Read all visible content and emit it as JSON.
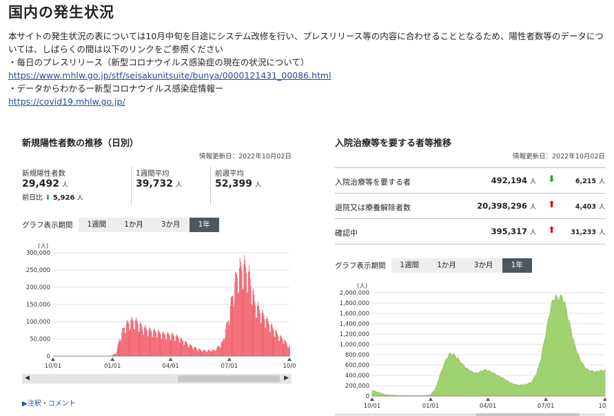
{
  "page": {
    "title": "国内の発生状況",
    "intro_line1": "本サイトの発生状況の表については10月中旬を目途にシステム改修を行い、プレスリリース等の内容に合わせることとなるため、陽性者数等のデータにつ",
    "intro_line2": "いては、しばらくの間は以下のリンクをご参照ください",
    "intro_line3": "・毎日のプレスリリース（新型コロナウイルス感染症の現在の状況について）",
    "link1": "https://www.mhlw.go.jp/stf/seisakunitsuite/bunya/0000121431_00086.html",
    "intro_line4": "・データからわかるー新型コロナウイルス感染症情報ー",
    "link2": "https://covid19.mhlw.go.jp/"
  },
  "left_panel": {
    "title": "新規陽性者数の推移（日別）",
    "updated": "情報更新日：2022年10月02日",
    "stats": [
      {
        "label": "新規陽性者数",
        "value": "29,492",
        "unit": "人"
      },
      {
        "label": "1週間平均",
        "value": "39,732",
        "unit": "人"
      },
      {
        "label": "前週平均",
        "value": "52,399",
        "unit": "人"
      }
    ],
    "prev_day_label": "前日比",
    "prev_day_arrow": "⬇",
    "prev_day_value": "5,926",
    "prev_day_unit": "人",
    "period_label": "グラフ表示期間",
    "period_buttons": [
      "1週間",
      "1か月",
      "3か月",
      "1年"
    ],
    "active_period": "1年",
    "note": "▶注釈・コメント"
  },
  "right_panel": {
    "title": "入院治療等を要する者等推移",
    "updated": "情報更新日：2022年10月02日",
    "rows": [
      {
        "label": "入院治療等を要する者",
        "value": "492,194",
        "unit": "人",
        "arrow": "⬇",
        "dir": "down",
        "delta": "6,215",
        "delta_unit": "人"
      },
      {
        "label": "退院又は療養解除者数",
        "value": "20,398,296",
        "unit": "人",
        "arrow": "⬆",
        "dir": "up",
        "delta": "4,403",
        "delta_unit": "人"
      },
      {
        "label": "確認中",
        "value": "395,317",
        "unit": "人",
        "arrow": "⬆",
        "dir": "up",
        "delta": "31,233",
        "delta_unit": "人"
      }
    ],
    "period_label": "グラフ表示期間",
    "period_buttons": [
      "1週間",
      "1か月",
      "3か月",
      "1年"
    ],
    "active_period": "1年"
  },
  "chart_data": [
    {
      "type": "bar",
      "ylabel": "(人)",
      "ylim": [
        0,
        300000
      ],
      "yticks": [
        "0",
        "50,000",
        "100,000",
        "150,000",
        "200,000",
        "250,000",
        "300,000"
      ],
      "xticks": [
        "10/01",
        "01/01",
        "04/01",
        "07/01",
        "10/0"
      ],
      "color": "#f0505f",
      "grid": true,
      "x_range": [
        "2021-10-01",
        "2022-10-02"
      ],
      "anchors": [
        [
          0,
          1200
        ],
        [
          20,
          400
        ],
        [
          60,
          150
        ],
        [
          82,
          300
        ],
        [
          90,
          1500
        ],
        [
          97,
          8000
        ],
        [
          103,
          50000
        ],
        [
          110,
          82000
        ],
        [
          117,
          95000
        ],
        [
          124,
          100000
        ],
        [
          131,
          93000
        ],
        [
          138,
          80000
        ],
        [
          145,
          74000
        ],
        [
          153,
          70000
        ],
        [
          160,
          68000
        ],
        [
          167,
          63000
        ],
        [
          173,
          61000
        ],
        [
          180,
          60000
        ],
        [
          187,
          58000
        ],
        [
          195,
          50000
        ],
        [
          202,
          42000
        ],
        [
          210,
          32000
        ],
        [
          220,
          23000
        ],
        [
          230,
          16000
        ],
        [
          240,
          15500
        ],
        [
          250,
          17000
        ],
        [
          262,
          38000
        ],
        [
          270,
          95000
        ],
        [
          278,
          175000
        ],
        [
          284,
          225000
        ],
        [
          290,
          245000
        ],
        [
          297,
          250000
        ],
        [
          304,
          220000
        ],
        [
          312,
          150000
        ],
        [
          320,
          125000
        ],
        [
          328,
          105000
        ],
        [
          335,
          90000
        ],
        [
          342,
          72000
        ],
        [
          350,
          55000
        ],
        [
          357,
          45000
        ],
        [
          362,
          35000
        ],
        [
          366,
          25000
        ]
      ],
      "amplitude": 0.22
    },
    {
      "type": "area",
      "ylabel": "(人)",
      "ylim": [
        0,
        2000000
      ],
      "yticks": [
        "0",
        "200,000",
        "400,000",
        "600,000",
        "800,000",
        "1,000,000",
        "1,200,000",
        "1,400,000",
        "1,600,000",
        "1,800,000",
        "2,000,000"
      ],
      "xticks": [
        "10/01",
        "01/01",
        "04/01",
        "07/01",
        "10/0"
      ],
      "color": "#9bcf68",
      "grid": true,
      "x_range": [
        "2021-10-01",
        "2022-10-02"
      ],
      "anchors": [
        [
          0,
          110000
        ],
        [
          10,
          70000
        ],
        [
          20,
          25000
        ],
        [
          40,
          8000
        ],
        [
          80,
          6000
        ],
        [
          92,
          20000
        ],
        [
          100,
          150000
        ],
        [
          108,
          450000
        ],
        [
          116,
          700000
        ],
        [
          122,
          820000
        ],
        [
          128,
          800000
        ],
        [
          135,
          720000
        ],
        [
          143,
          600000
        ],
        [
          150,
          520000
        ],
        [
          157,
          470000
        ],
        [
          163,
          440000
        ],
        [
          170,
          470000
        ],
        [
          178,
          510000
        ],
        [
          186,
          470000
        ],
        [
          194,
          420000
        ],
        [
          200,
          380000
        ],
        [
          210,
          310000
        ],
        [
          220,
          240000
        ],
        [
          230,
          210000
        ],
        [
          240,
          220000
        ],
        [
          250,
          260000
        ],
        [
          258,
          420000
        ],
        [
          265,
          700000
        ],
        [
          272,
          1150000
        ],
        [
          278,
          1550000
        ],
        [
          283,
          1820000
        ],
        [
          288,
          1920000
        ],
        [
          293,
          1880000
        ],
        [
          298,
          1930000
        ],
        [
          303,
          1780000
        ],
        [
          310,
          1400000
        ],
        [
          318,
          1000000
        ],
        [
          326,
          720000
        ],
        [
          334,
          560000
        ],
        [
          340,
          500000
        ],
        [
          346,
          480000
        ],
        [
          352,
          470000
        ],
        [
          358,
          490000
        ],
        [
          366,
          495000
        ]
      ],
      "amplitude": 0.03
    }
  ]
}
